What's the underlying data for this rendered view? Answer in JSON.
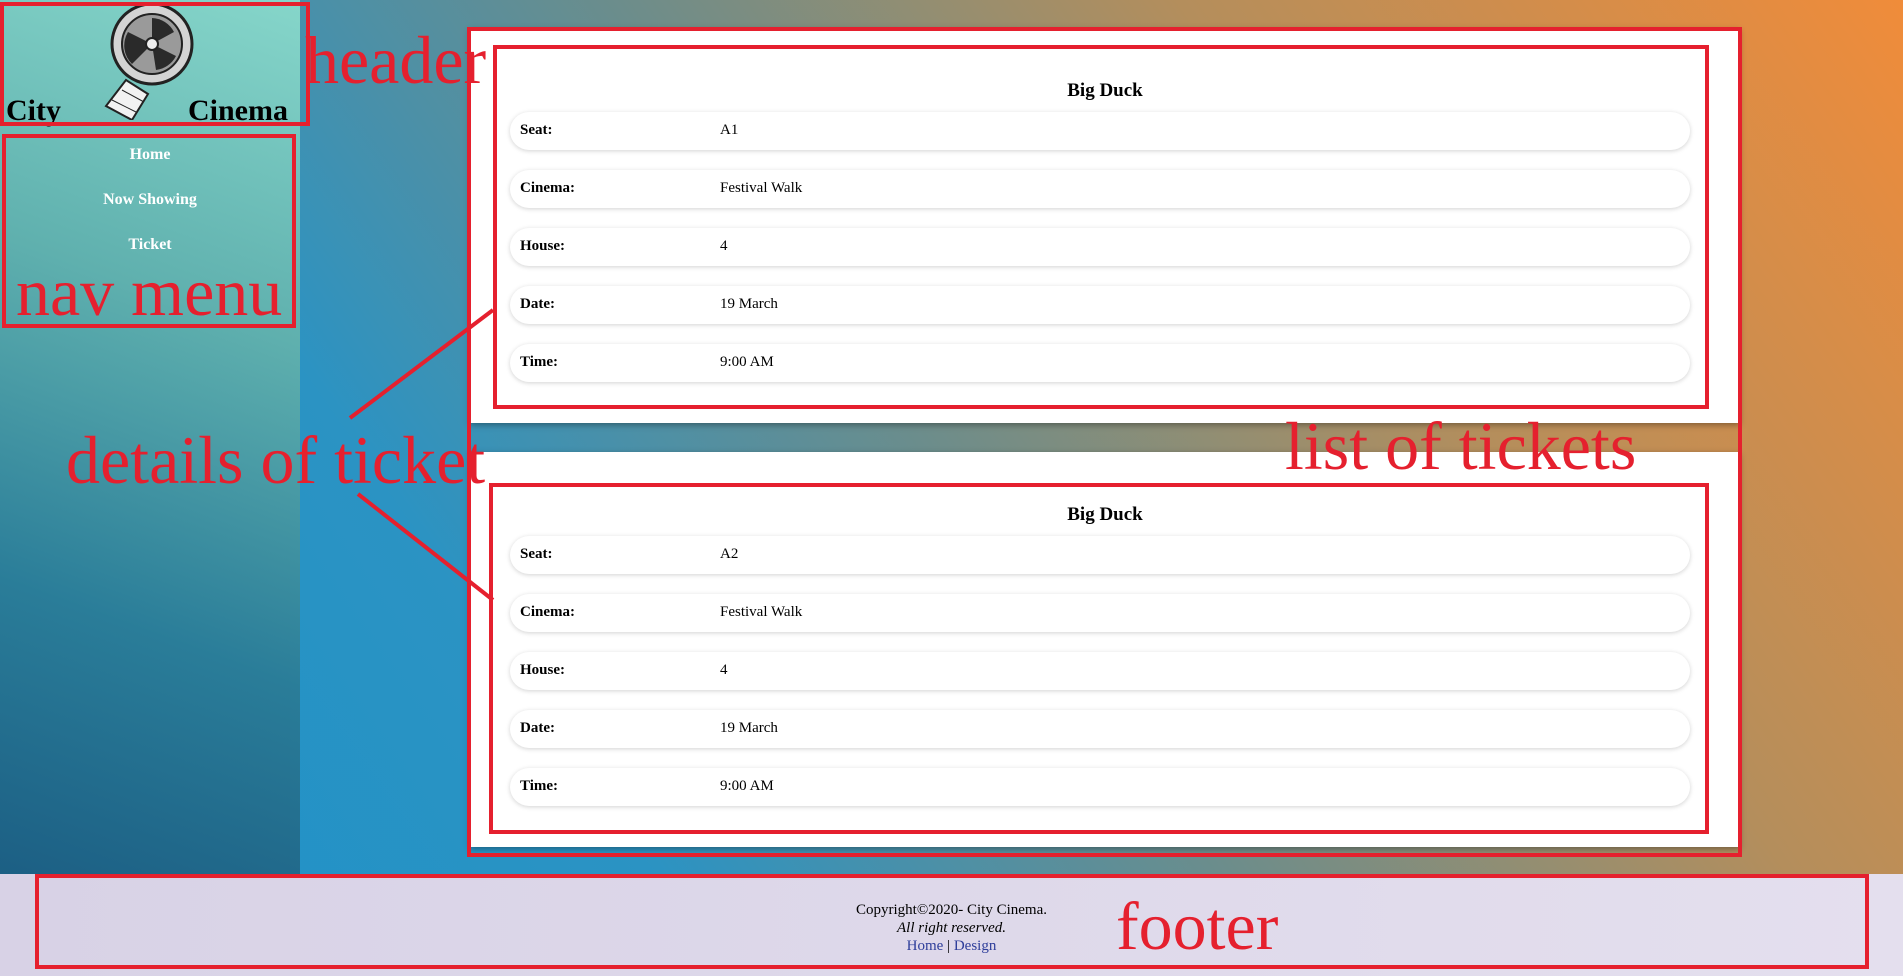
{
  "header": {
    "logo_left": "City",
    "logo_right": "Cinema"
  },
  "nav": {
    "items": [
      {
        "label": "Home"
      },
      {
        "label": "Now Showing"
      },
      {
        "label": "Ticket"
      }
    ]
  },
  "tickets": [
    {
      "title": "Big Duck",
      "rows": [
        {
          "label": "Seat:",
          "value": "A1"
        },
        {
          "label": "Cinema:",
          "value": "Festival Walk"
        },
        {
          "label": "House:",
          "value": "4"
        },
        {
          "label": "Date:",
          "value": "19 March"
        },
        {
          "label": "Time:",
          "value": "9:00 AM"
        }
      ]
    },
    {
      "title": "Big Duck",
      "rows": [
        {
          "label": "Seat:",
          "value": "A2"
        },
        {
          "label": "Cinema:",
          "value": "Festival Walk"
        },
        {
          "label": "House:",
          "value": "4"
        },
        {
          "label": "Date:",
          "value": "19 March"
        },
        {
          "label": "Time:",
          "value": "9:00 AM"
        }
      ]
    }
  ],
  "footer": {
    "copyright": "Copyright©2020- City Cinema.",
    "rights": "All right reserved.",
    "link_home": "Home",
    "separator": "|",
    "link_design": "Design"
  },
  "annotations": {
    "header": "header",
    "nav_menu": "nav menu",
    "details": "details of ticket",
    "list": "list of tickets",
    "footer": "footer"
  },
  "colors": {
    "annotation": "#e5202e",
    "link": "#2d3d9a"
  }
}
